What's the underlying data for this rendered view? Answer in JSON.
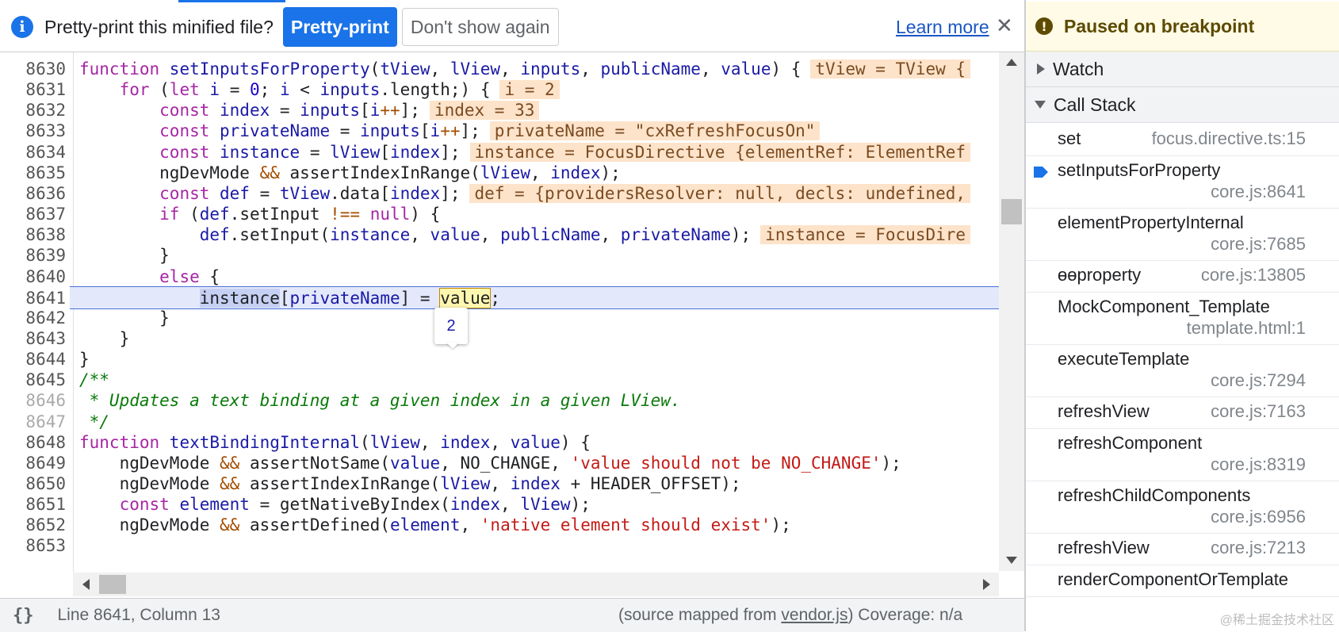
{
  "infobar": {
    "message": "Pretty-print this minified file?",
    "pretty_print_label": "Pretty-print",
    "dont_show_label": "Don't show again",
    "learn_more_label": "Learn more",
    "close_glyph": "✕",
    "info_glyph": "i"
  },
  "tooltip": {
    "value": "2"
  },
  "code_lines": [
    {
      "num": "8630",
      "dim": false
    },
    {
      "num": "8631",
      "dim": false
    },
    {
      "num": "8632",
      "dim": false
    },
    {
      "num": "8633",
      "dim": false
    },
    {
      "num": "8634",
      "dim": false
    },
    {
      "num": "8635",
      "dim": false
    },
    {
      "num": "8636",
      "dim": false
    },
    {
      "num": "8637",
      "dim": false
    },
    {
      "num": "8638",
      "dim": false
    },
    {
      "num": "8639",
      "dim": false
    },
    {
      "num": "8640",
      "dim": false
    },
    {
      "num": "8641",
      "dim": false
    },
    {
      "num": "8642",
      "dim": false
    },
    {
      "num": "8643",
      "dim": false
    },
    {
      "num": "8644",
      "dim": false
    },
    {
      "num": "8645",
      "dim": false
    },
    {
      "num": "8646",
      "dim": true
    },
    {
      "num": "8647",
      "dim": true
    },
    {
      "num": "8648",
      "dim": false
    },
    {
      "num": "8649",
      "dim": false
    },
    {
      "num": "8650",
      "dim": false
    },
    {
      "num": "8651",
      "dim": false
    },
    {
      "num": "8652",
      "dim": false
    },
    {
      "num": "8653",
      "dim": false
    }
  ],
  "code": {
    "l8630": [
      [
        "kw",
        "function "
      ],
      [
        "fn",
        "setInputsForProperty"
      ],
      [
        "plain",
        "("
      ],
      [
        "id",
        "tView"
      ],
      [
        "plain",
        ", "
      ],
      [
        "id",
        "lView"
      ],
      [
        "plain",
        ", "
      ],
      [
        "id",
        "inputs"
      ],
      [
        "plain",
        ", "
      ],
      [
        "id",
        "publicName"
      ],
      [
        "plain",
        ", "
      ],
      [
        "id",
        "value"
      ],
      [
        "plain",
        ") {"
      ],
      [
        "inl",
        "tView = TView {"
      ]
    ],
    "l8631": [
      [
        "plain",
        "    "
      ],
      [
        "kw",
        "for "
      ],
      [
        "plain",
        "("
      ],
      [
        "kw",
        "let "
      ],
      [
        "id",
        "i"
      ],
      [
        "plain",
        " = "
      ],
      [
        "num",
        "0"
      ],
      [
        "plain",
        "; "
      ],
      [
        "id",
        "i"
      ],
      [
        "plain",
        " < "
      ],
      [
        "id",
        "inputs"
      ],
      [
        "plain",
        ".length;) {"
      ],
      [
        "inl",
        "i = 2"
      ]
    ],
    "l8632": [
      [
        "plain",
        "        "
      ],
      [
        "kw",
        "const "
      ],
      [
        "id",
        "index"
      ],
      [
        "plain",
        " = "
      ],
      [
        "id",
        "inputs"
      ],
      [
        "plain",
        "["
      ],
      [
        "id",
        "i"
      ],
      [
        "op",
        "++"
      ],
      [
        "plain",
        "];"
      ],
      [
        "inl",
        "index = 33"
      ]
    ],
    "l8633": [
      [
        "plain",
        "        "
      ],
      [
        "kw",
        "const "
      ],
      [
        "id",
        "privateName"
      ],
      [
        "plain",
        " = "
      ],
      [
        "id",
        "inputs"
      ],
      [
        "plain",
        "["
      ],
      [
        "id",
        "i"
      ],
      [
        "op",
        "++"
      ],
      [
        "plain",
        "];"
      ],
      [
        "inl",
        "privateName = \"cxRefreshFocusOn\""
      ]
    ],
    "l8634": [
      [
        "plain",
        "        "
      ],
      [
        "kw",
        "const "
      ],
      [
        "id",
        "instance"
      ],
      [
        "plain",
        " = "
      ],
      [
        "id",
        "lView"
      ],
      [
        "plain",
        "["
      ],
      [
        "id",
        "index"
      ],
      [
        "plain",
        "];"
      ],
      [
        "inl",
        "instance = FocusDirective {elementRef: ElementRef"
      ]
    ],
    "l8635": [
      [
        "plain",
        "        ngDevMode "
      ],
      [
        "op",
        "&&"
      ],
      [
        "plain",
        " assertIndexInRange("
      ],
      [
        "id",
        "lView"
      ],
      [
        "plain",
        ", "
      ],
      [
        "id",
        "index"
      ],
      [
        "plain",
        ");"
      ]
    ],
    "l8636": [
      [
        "plain",
        "        "
      ],
      [
        "kw",
        "const "
      ],
      [
        "id",
        "def"
      ],
      [
        "plain",
        " = "
      ],
      [
        "id",
        "tView"
      ],
      [
        "plain",
        ".data["
      ],
      [
        "id",
        "index"
      ],
      [
        "plain",
        "];"
      ],
      [
        "inl",
        "def = {providersResolver: null, decls: undefined,"
      ]
    ],
    "l8637": [
      [
        "plain",
        "        "
      ],
      [
        "kw",
        "if "
      ],
      [
        "plain",
        "("
      ],
      [
        "id",
        "def"
      ],
      [
        "plain",
        ".setInput "
      ],
      [
        "op",
        "!=="
      ],
      [
        "plain",
        " "
      ],
      [
        "kw",
        "null"
      ],
      [
        "plain",
        ") {"
      ]
    ],
    "l8638": [
      [
        "plain",
        "            "
      ],
      [
        "id",
        "def"
      ],
      [
        "plain",
        ".setInput("
      ],
      [
        "id",
        "instance"
      ],
      [
        "plain",
        ", "
      ],
      [
        "id",
        "value"
      ],
      [
        "plain",
        ", "
      ],
      [
        "id",
        "publicName"
      ],
      [
        "plain",
        ", "
      ],
      [
        "id",
        "privateName"
      ],
      [
        "plain",
        ");"
      ],
      [
        "inl",
        "instance = FocusDire"
      ]
    ],
    "l8639": [
      [
        "plain",
        "        }"
      ]
    ],
    "l8640": [
      [
        "plain",
        "        "
      ],
      [
        "kw",
        "else "
      ],
      [
        "plain",
        "{"
      ]
    ],
    "l8641": [
      [
        "plain",
        "            "
      ],
      [
        "sel",
        "instance"
      ],
      [
        "plain",
        "["
      ],
      [
        "id",
        "privateName"
      ],
      [
        "plain",
        "] = "
      ],
      [
        "vbox",
        "value"
      ],
      [
        "plain",
        ";"
      ]
    ],
    "l8642": [
      [
        "plain",
        "        }"
      ]
    ],
    "l8643": [
      [
        "plain",
        "    }"
      ]
    ],
    "l8644": [
      [
        "plain",
        "}"
      ]
    ],
    "l8645": [
      [
        "cmt",
        "/**"
      ]
    ],
    "l8646": [
      [
        "cmt",
        " * Updates a text binding at a given index in a given LView."
      ]
    ],
    "l8647": [
      [
        "cmt",
        " */"
      ]
    ],
    "l8648": [
      [
        "kw",
        "function "
      ],
      [
        "fn",
        "textBindingInternal"
      ],
      [
        "plain",
        "("
      ],
      [
        "id",
        "lView"
      ],
      [
        "plain",
        ", "
      ],
      [
        "id",
        "index"
      ],
      [
        "plain",
        ", "
      ],
      [
        "id",
        "value"
      ],
      [
        "plain",
        ") {"
      ]
    ],
    "l8649": [
      [
        "plain",
        "    ngDevMode "
      ],
      [
        "op",
        "&&"
      ],
      [
        "plain",
        " assertNotSame("
      ],
      [
        "id",
        "value"
      ],
      [
        "plain",
        ", NO_CHANGE, "
      ],
      [
        "str",
        "'value should not be NO_CHANGE'"
      ],
      [
        "plain",
        ");"
      ]
    ],
    "l8650": [
      [
        "plain",
        "    ngDevMode "
      ],
      [
        "op",
        "&&"
      ],
      [
        "plain",
        " assertIndexInRange("
      ],
      [
        "id",
        "lView"
      ],
      [
        "plain",
        ", "
      ],
      [
        "id",
        "index"
      ],
      [
        "plain",
        " + HEADER_OFFSET);"
      ]
    ],
    "l8651": [
      [
        "plain",
        "    "
      ],
      [
        "kw",
        "const "
      ],
      [
        "id",
        "element"
      ],
      [
        "plain",
        " = getNativeByIndex("
      ],
      [
        "id",
        "index"
      ],
      [
        "plain",
        ", "
      ],
      [
        "id",
        "lView"
      ],
      [
        "plain",
        ");"
      ]
    ],
    "l8652": [
      [
        "plain",
        "    ngDevMode "
      ],
      [
        "op",
        "&&"
      ],
      [
        "plain",
        " assertDefined("
      ],
      [
        "id",
        "element"
      ],
      [
        "plain",
        ", "
      ],
      [
        "str",
        "'native element should exist'"
      ],
      [
        "plain",
        ");"
      ]
    ],
    "l8653": []
  },
  "status": {
    "braces": "{}",
    "position": "Line 8641, Column 13",
    "source_prefix": "(source mapped from ",
    "source_link": "vendor.js",
    "source_suffix": ")  Coverage: n/a"
  },
  "debugger": {
    "paused_label": "Paused on breakpoint",
    "paused_glyph": "!",
    "watch_label": "Watch",
    "callstack_label": "Call Stack",
    "frames": [
      {
        "name": "set",
        "location": "focus.directive.ts:15",
        "two_line": false,
        "current": false
      },
      {
        "name": "setInputsForProperty",
        "location": "core.js:8641",
        "two_line": true,
        "current": true
      },
      {
        "name": "elementPropertyInternal",
        "location": "core.js:7685",
        "two_line": true,
        "current": false
      },
      {
        "name": "ɵɵproperty",
        "location": "core.js:13805",
        "two_line": false,
        "current": false
      },
      {
        "name": "MockComponent_Template",
        "location": "template.html:1",
        "two_line": true,
        "current": false
      },
      {
        "name": "executeTemplate",
        "location": "core.js:7294",
        "two_line": true,
        "current": false
      },
      {
        "name": "refreshView",
        "location": "core.js:7163",
        "two_line": false,
        "current": false
      },
      {
        "name": "refreshComponent",
        "location": "core.js:8319",
        "two_line": true,
        "current": false
      },
      {
        "name": "refreshChildComponents",
        "location": "core.js:6956",
        "two_line": true,
        "current": false
      },
      {
        "name": "refreshView",
        "location": "core.js:7213",
        "two_line": false,
        "current": false
      },
      {
        "name": "renderComponentOrTemplate",
        "location": "",
        "two_line": false,
        "current": false
      }
    ]
  },
  "watermark": "@稀土掘金技术社区",
  "colors": {
    "accent": "#1a73e8",
    "paused_bg": "#fffbe6",
    "inline_value_bg": "#fde3c9",
    "current_line_bg": "#e3e8fb"
  }
}
